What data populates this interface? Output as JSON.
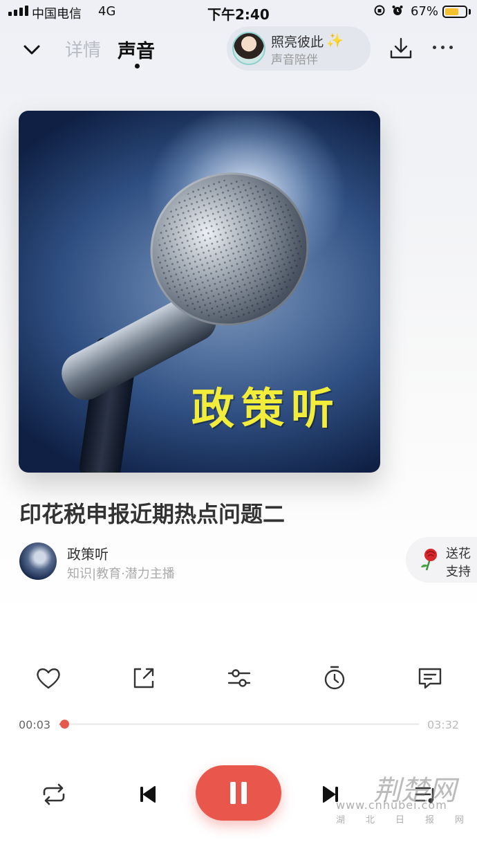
{
  "status_bar": {
    "carrier": "中国电信",
    "network": "4G",
    "time": "下午2:40",
    "battery_percent": "67%",
    "battery_level": 0.67
  },
  "nav": {
    "tab_details": "详情",
    "tab_sound": "声音",
    "companion": {
      "title": "照亮彼此",
      "subtitle": "声音陪伴"
    }
  },
  "cover": {
    "overlay_text": "政策听"
  },
  "track": {
    "title": "印花税申报近期热点问题二",
    "author_name": "政策听",
    "author_meta": "知识|教育·潜力主播"
  },
  "gift": {
    "line1": "送花",
    "line2": "支持"
  },
  "actions": [
    {
      "icon": "heart-icon"
    },
    {
      "icon": "share-icon"
    },
    {
      "icon": "equalizer-icon"
    },
    {
      "icon": "timer-icon"
    },
    {
      "icon": "comment-icon"
    }
  ],
  "progress": {
    "current": "00:03",
    "total": "03:32",
    "fraction": 0.014
  },
  "controls": {
    "repeat": "repeat-icon",
    "prev": "previous-icon",
    "pause": "pause-icon",
    "next": "next-icon",
    "playlist": "playlist-icon"
  },
  "watermark": {
    "text": "荆楚网",
    "url": "www.cnhubei.com",
    "sub": "湖北日报网"
  },
  "colors": {
    "accent": "#e9574c",
    "cover_text": "#f2ec3b"
  }
}
